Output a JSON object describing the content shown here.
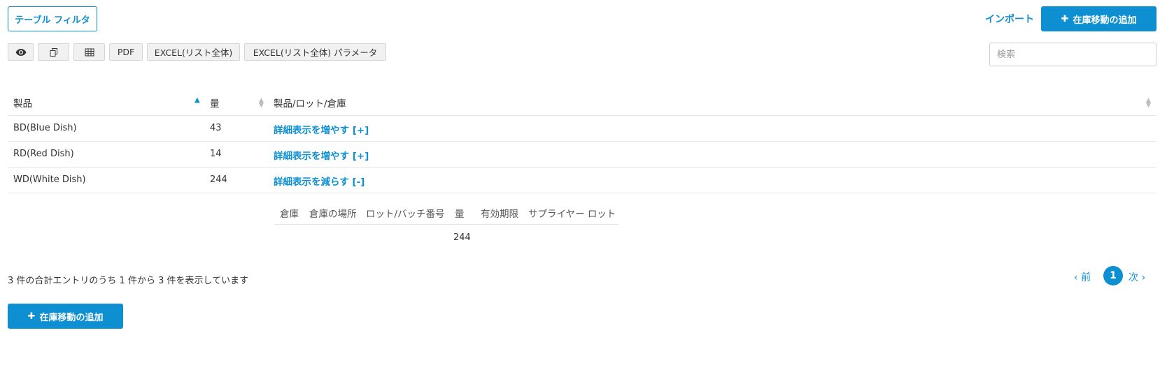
{
  "toolbar": {
    "table_filter": "テーブル フィルタ",
    "import": "インポート",
    "add_stock_move": "在庫移動の追加",
    "export_buttons": {
      "view_icon": "eye-icon",
      "copy_icon": "copy-icon",
      "grid_icon": "table-icon",
      "pdf": "PDF",
      "excel_all": "EXCEL(リスト全体)",
      "excel_all_params": "EXCEL(リスト全体) パラメータ"
    },
    "search_placeholder": "検索"
  },
  "table": {
    "headers": {
      "product": "製品",
      "quantity": "量",
      "product_lot_warehouse": "製品/ロット/倉庫"
    },
    "sorted_column": "product",
    "sort_direction": "ascending",
    "rows": [
      {
        "product": "BD(Blue Dish)",
        "quantity": "43",
        "detail_link": "詳細表示を増やす [+]"
      },
      {
        "product": "RD(Red Dish)",
        "quantity": "14",
        "detail_link": "詳細表示を増やす [+]"
      },
      {
        "product": "WD(White Dish)",
        "quantity": "244",
        "detail_link": "詳細表示を減らす [-]"
      }
    ],
    "detail_table": {
      "headers": [
        "倉庫",
        "倉庫の場所",
        "ロット/バッチ番号",
        "量",
        "有効期限",
        "サプライヤー ロット"
      ],
      "row": {
        "quantity": "244"
      }
    }
  },
  "footer": {
    "info": "3 件の合計エントリのうち 1 件から 3 件を表示しています",
    "prev": "前",
    "current_page": "1",
    "next": "次",
    "add_stock_move": "在庫移動の追加"
  },
  "colors": {
    "accent": "#0d8fd1"
  }
}
